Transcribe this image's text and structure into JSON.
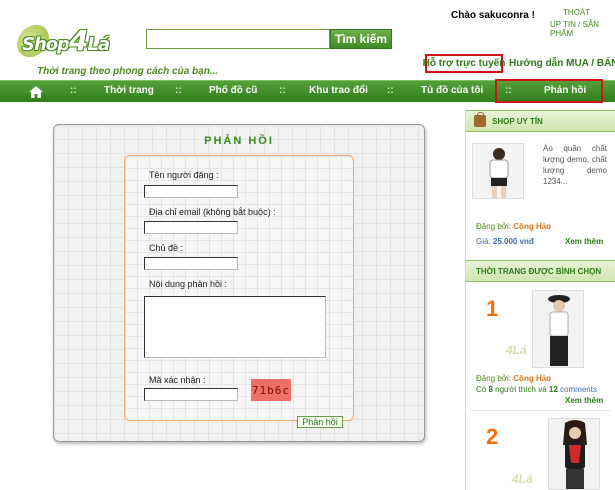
{
  "header": {
    "logo_text": "Shop4Lá",
    "logo_prefix": "Shop",
    "logo_number": "4",
    "logo_suffix": "Lá",
    "tagline": "Thời trang theo phong cách của bạn...",
    "search_placeholder": "",
    "search_button": "Tìm kiếm",
    "greeting": "Chào sakuconra !",
    "logout": "THOÁT",
    "upload": "UP TIN / SẢN PHẨM",
    "support_link": "Hỗ trợ trực tuyến",
    "guide_link": "Hướng dẫn MUA / BÁN hàng"
  },
  "nav": {
    "separator": "::",
    "items": [
      "Thời trang",
      "Phố đồ cũ",
      "Khu trao đổi",
      "Tủ đồ của tôi",
      "Phản hồi"
    ]
  },
  "form": {
    "title": "PHẢN HỒI",
    "name_label": "Tên người đăng :",
    "email_label": "Địa chỉ email (không bắt buộc) :",
    "subject_label": "Chủ đề :",
    "content_label": "Nội dung phản hồi :",
    "captcha_label": "Mã xác nhận :",
    "captcha_text": "71b6c",
    "submit_label": "Phản hồi"
  },
  "sidebar": {
    "shop_title": "SHOP UY TÍN",
    "product": {
      "description": "Áo quần chất lượng demo, chất lượng demo 1234...",
      "posted_label": "Đăng bởi:",
      "posted_by": "Công Hảo",
      "price_label": "Giá:",
      "price": "25.000 vnđ",
      "more": "Xem thêm"
    },
    "voted_title": "THỜI TRANG ĐƯỢC BÌNH CHỌN",
    "voted": [
      {
        "rank": "1",
        "posted_label": "Đăng bởi:",
        "posted_by": "Công Hảo",
        "likes_prefix": "Có",
        "likes": "8",
        "likes_mid": "người thích và",
        "comments": "12",
        "comments_label": "comments",
        "more": "Xem thêm"
      },
      {
        "rank": "2"
      }
    ],
    "watermark": "4Lá"
  },
  "colors": {
    "brand_green": "#2f7a18",
    "nav_green": "#3f8a24",
    "highlight_red": "#d01418",
    "accent_orange": "#f07010"
  }
}
